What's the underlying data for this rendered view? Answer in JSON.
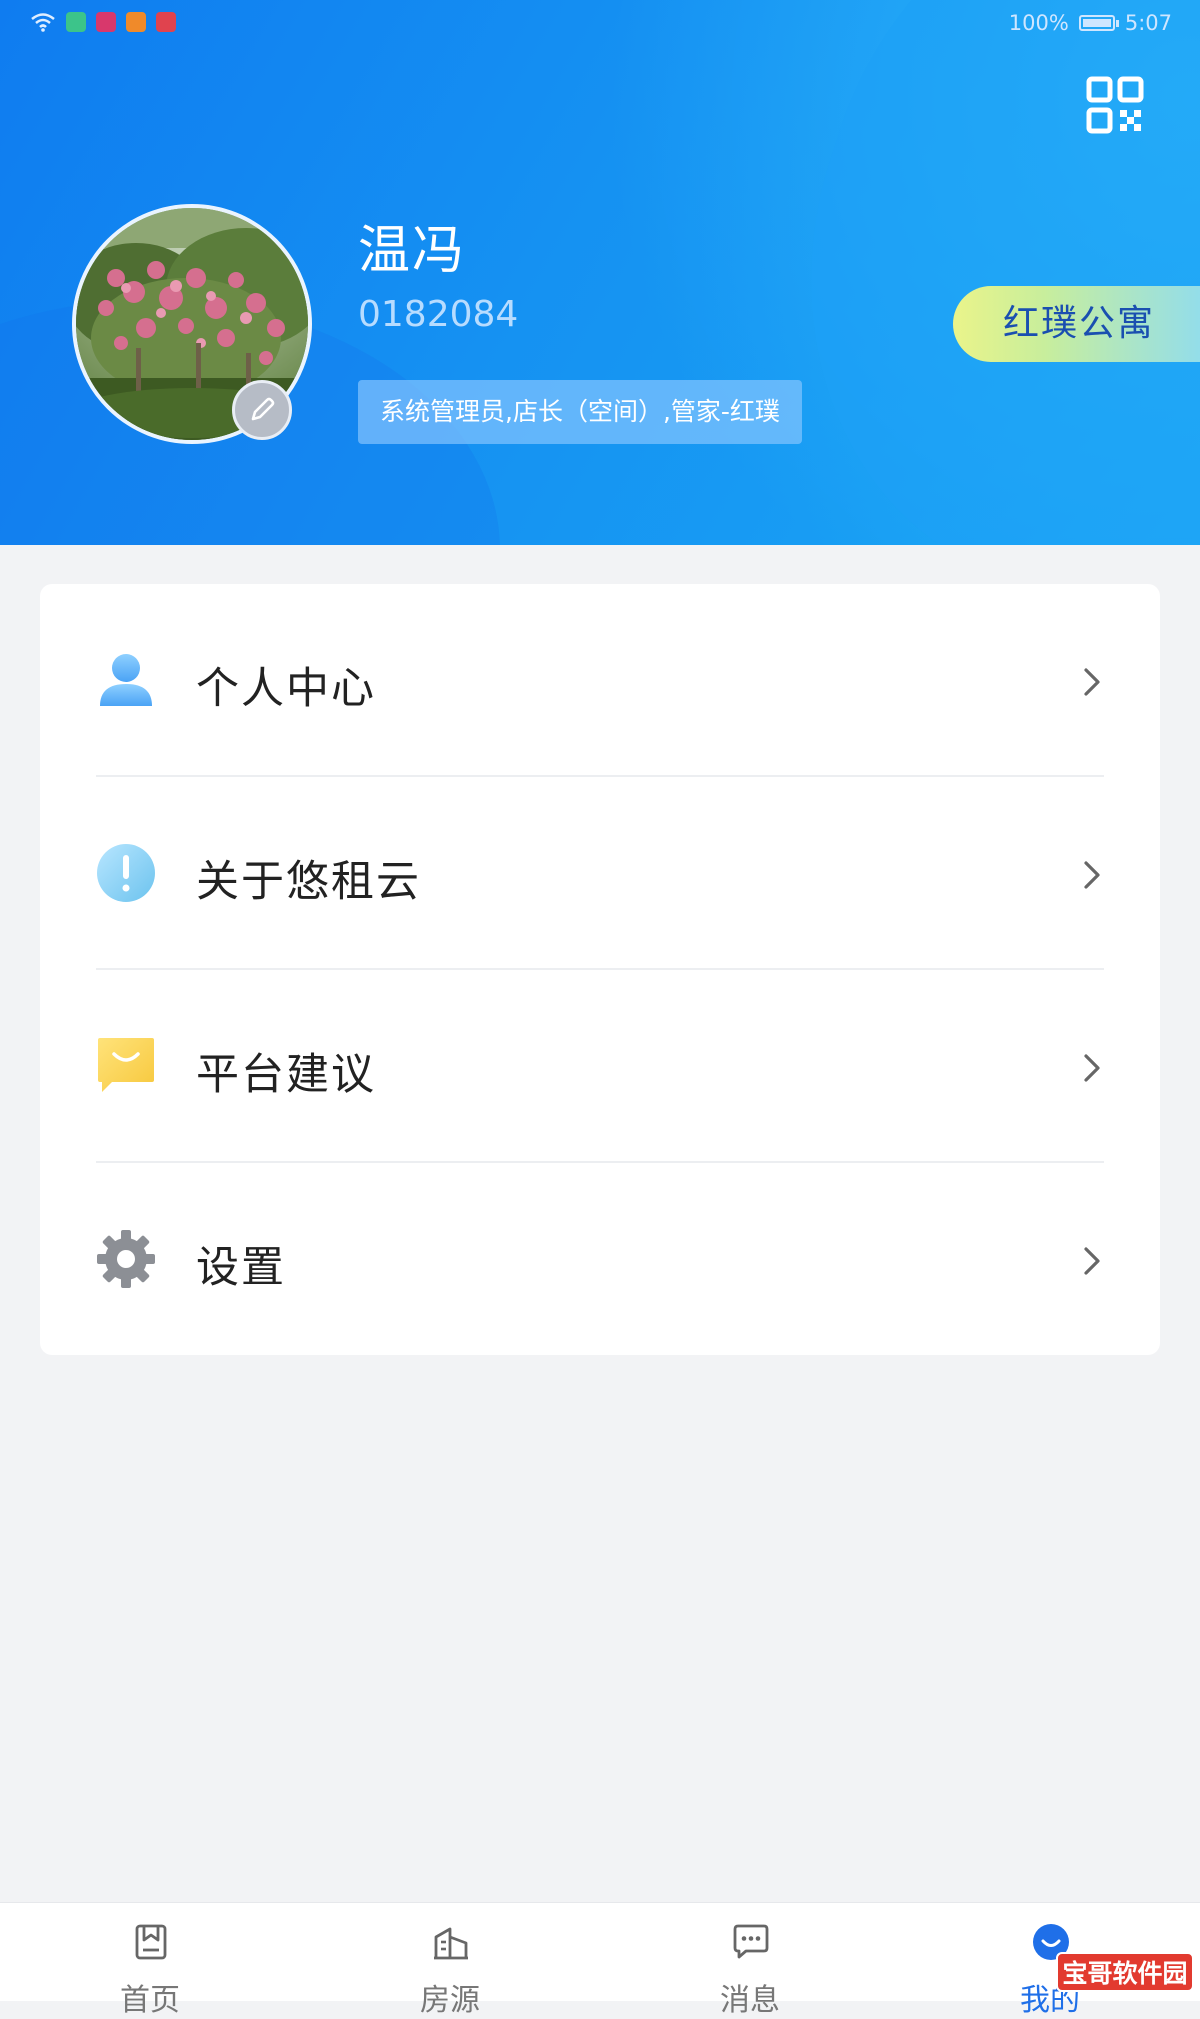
{
  "status_bar": {
    "battery": "100%",
    "time": "5:07"
  },
  "profile": {
    "name": "温冯",
    "user_id": "0182084",
    "roles": "系统管理员,店长（空间）,管家-红璞",
    "apartment_label": "红璞公寓"
  },
  "menu": {
    "items": [
      {
        "label": "个人中心",
        "icon": "person-icon"
      },
      {
        "label": "关于悠租云",
        "icon": "info-icon"
      },
      {
        "label": "平台建议",
        "icon": "feedback-icon"
      },
      {
        "label": "设置",
        "icon": "gear-icon"
      }
    ]
  },
  "bottom_nav": {
    "items": [
      {
        "label": "首页",
        "icon": "home-icon"
      },
      {
        "label": "房源",
        "icon": "building-icon"
      },
      {
        "label": "消息",
        "icon": "message-icon"
      },
      {
        "label": "我的",
        "icon": "profile-icon",
        "active": true
      }
    ]
  },
  "watermark": "宝哥软件园",
  "colors": {
    "header_blue": "#0f7cf0",
    "accent_blue": "#1f6fe8",
    "apartment_gradient_start": "#eaf48a",
    "apartment_gradient_end": "#8fdcf0"
  }
}
